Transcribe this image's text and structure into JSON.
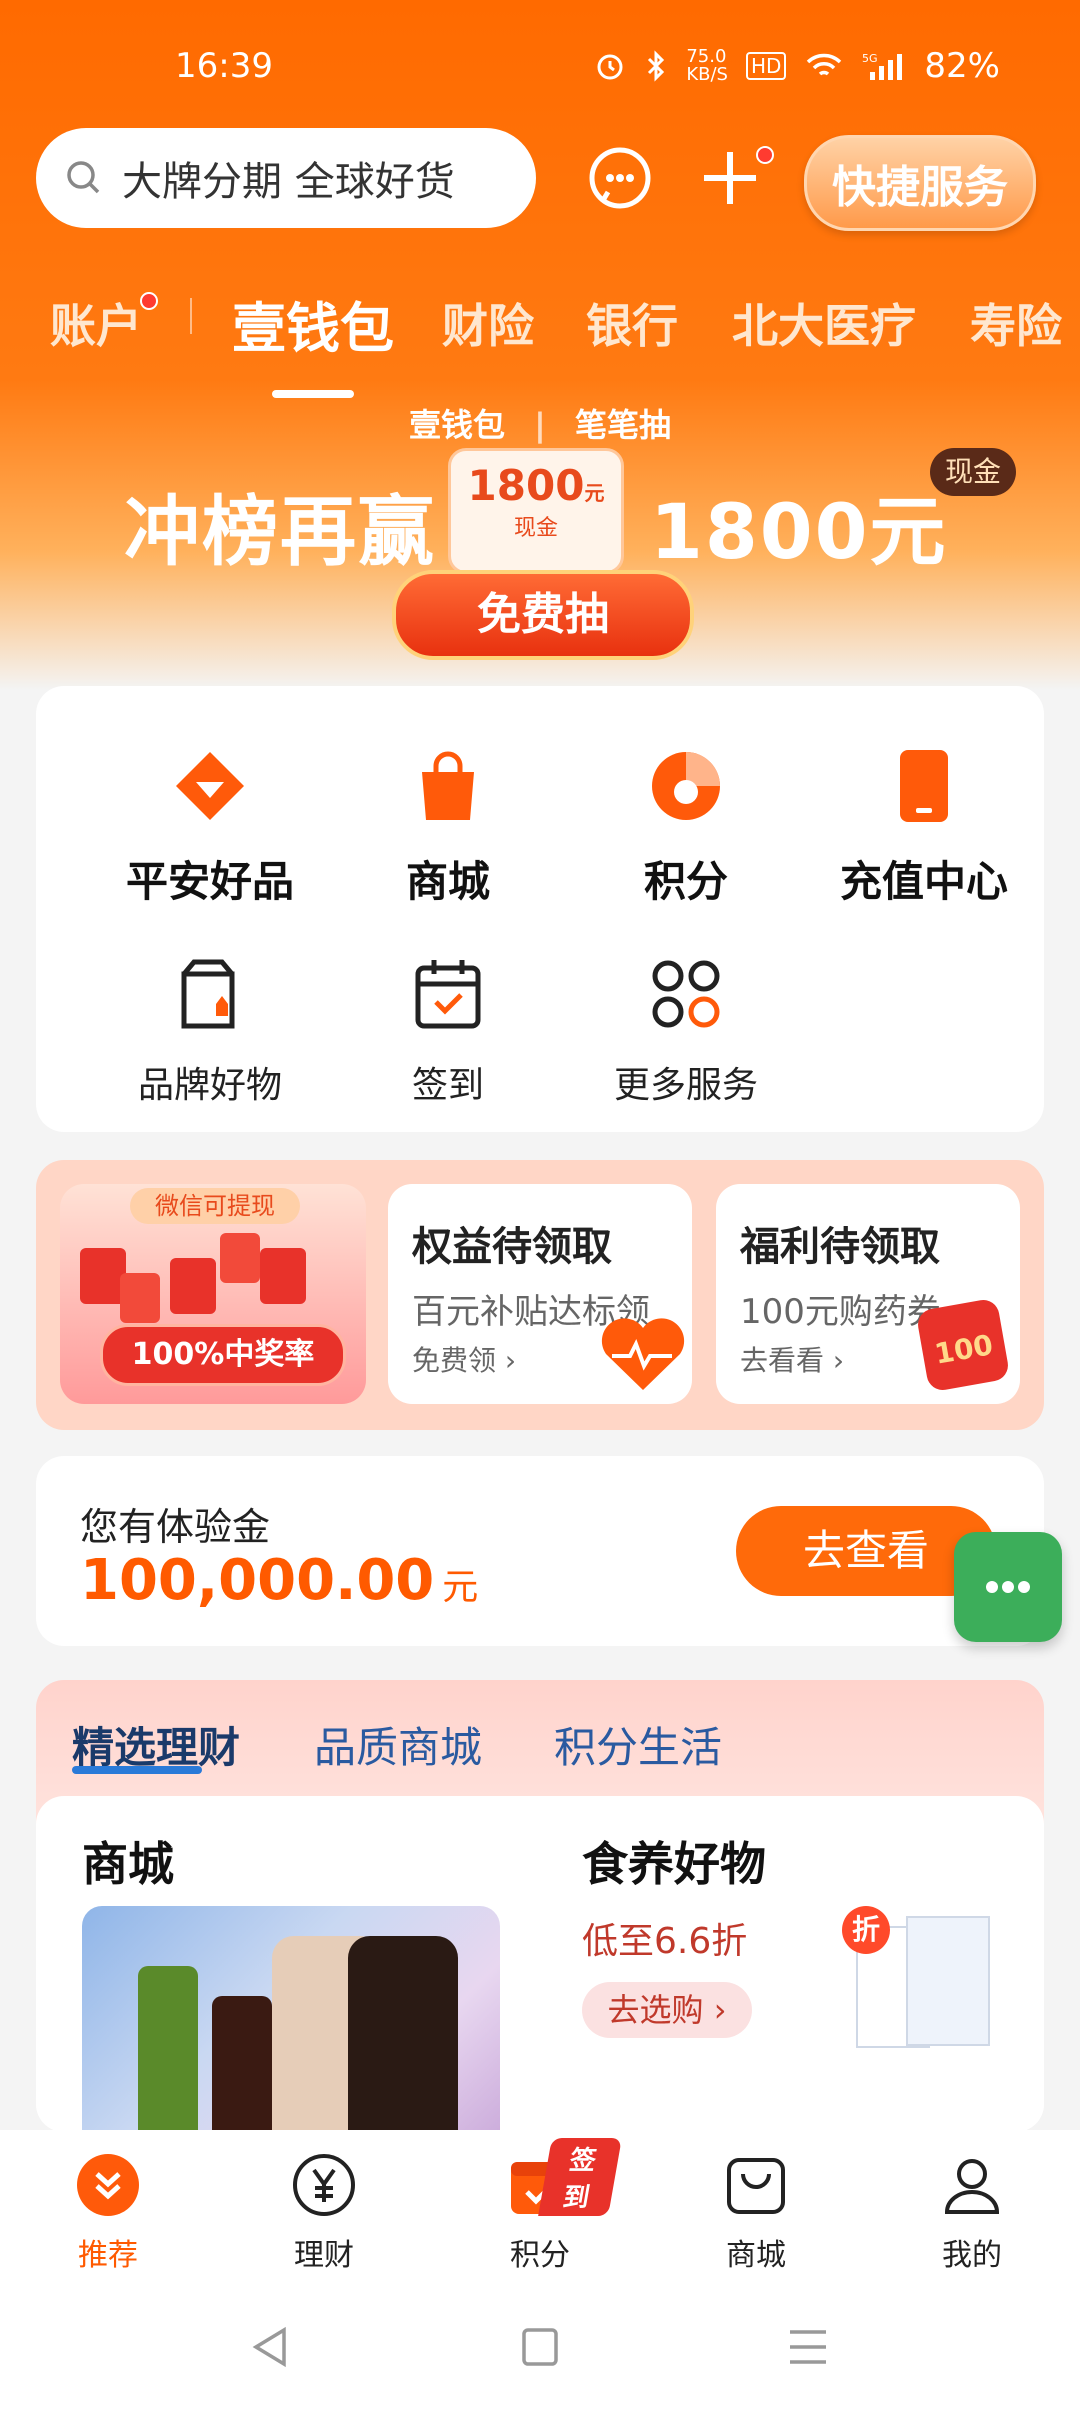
{
  "status": {
    "time": "16:39",
    "speed": "75.0\nKB/S",
    "battery": "82%"
  },
  "search": {
    "placeholder": "大牌分期 全球好货"
  },
  "header": {
    "quick_service": "快捷服务"
  },
  "tabs": [
    {
      "label": "账户"
    },
    {
      "label": "壹钱包"
    },
    {
      "label": "财险"
    },
    {
      "label": "银行"
    },
    {
      "label": "北大医疗"
    },
    {
      "label": "寿险"
    }
  ],
  "banner": {
    "sub_left": "壹钱包",
    "sub_right": "笔笔抽",
    "headline_left": "冲榜再赢",
    "headline_right": "1800元",
    "cash_amount": "1800",
    "cash_unit": "元",
    "cash_label": "现金",
    "badge": "现金",
    "cta": "免费抽"
  },
  "services": {
    "row1": [
      {
        "label": "平安好品",
        "icon": "diamond-icon"
      },
      {
        "label": "商城",
        "icon": "bag-icon"
      },
      {
        "label": "积分",
        "icon": "points-icon"
      },
      {
        "label": "充值中心",
        "icon": "phone-icon"
      }
    ],
    "row2": [
      {
        "label": "品牌好物",
        "icon": "brand-bag-icon"
      },
      {
        "label": "签到",
        "icon": "calendar-check-icon"
      },
      {
        "label": "更多服务",
        "icon": "grid-icon"
      }
    ]
  },
  "promo": {
    "left_top": "微信可提现",
    "left_badge": "100%中奖率",
    "card1": {
      "title": "权益待领取",
      "sub": "百元补贴达标领",
      "link": "免费领"
    },
    "card2": {
      "title": "福利待领取",
      "sub": "100元购药券",
      "link": "去看看",
      "badge": "100"
    }
  },
  "experience": {
    "title": "您有体验金",
    "amount": "100,000.00",
    "unit": "元",
    "button": "去查看"
  },
  "finance": {
    "tabs": [
      {
        "label": "精选理财"
      },
      {
        "label": "品质商城"
      },
      {
        "label": "积分生活"
      }
    ],
    "left_title": "商城",
    "right_title": "食养好物",
    "right_sub": "低至6.6折",
    "right_button": "去选购",
    "discount_tag": "折"
  },
  "bottom_nav": [
    {
      "label": "推荐"
    },
    {
      "label": "理财"
    },
    {
      "label": "积分",
      "badge": "签到"
    },
    {
      "label": "商城"
    },
    {
      "label": "我的"
    }
  ],
  "colors": {
    "accent": "#ff6a00",
    "green_fab": "#3cae5a"
  }
}
